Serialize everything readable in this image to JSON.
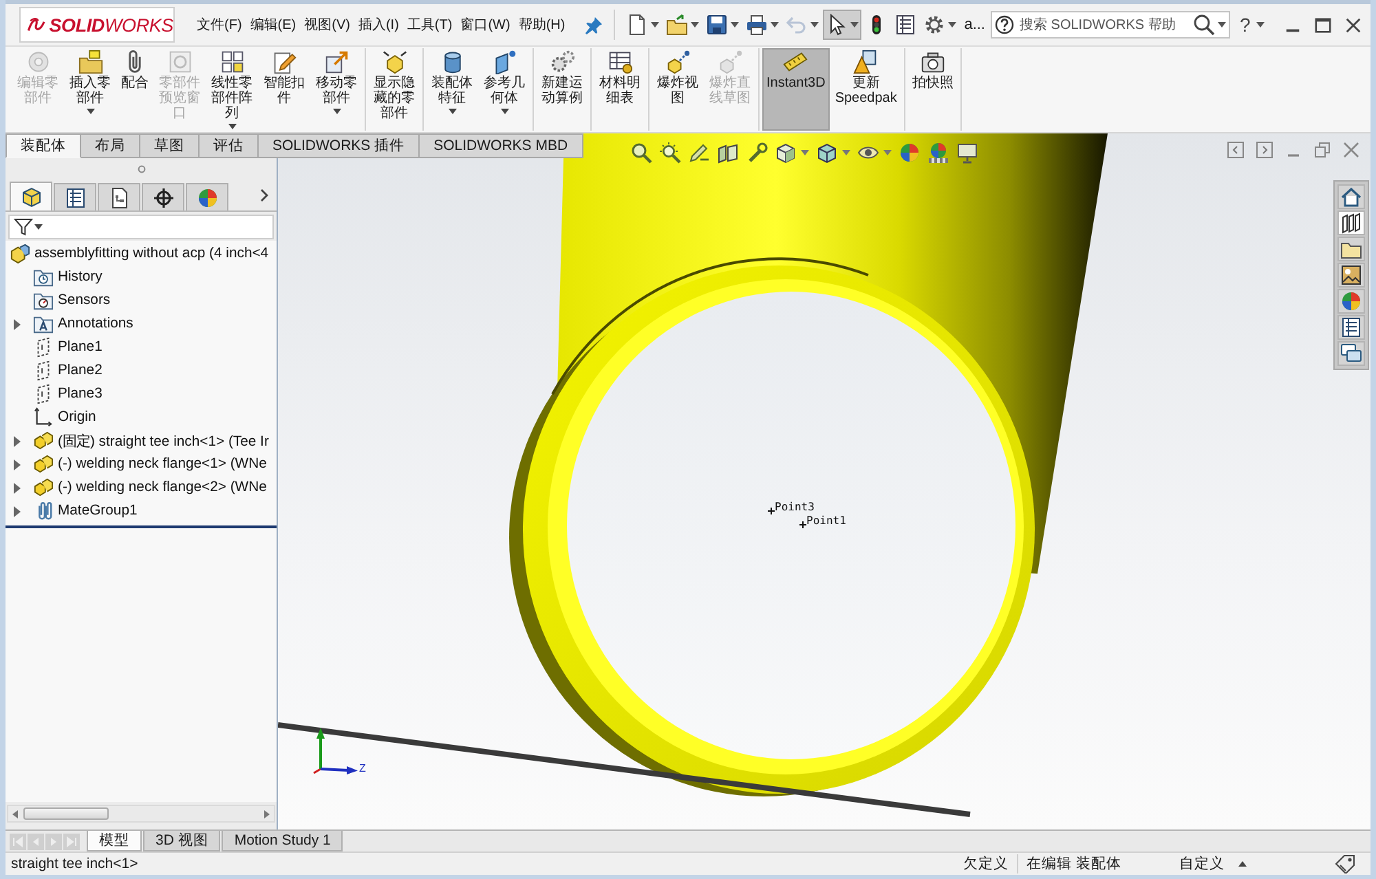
{
  "window": {
    "logo": "**SOLID**WORKS",
    "title": "a..."
  },
  "menu": [
    {
      "label": "文件(F)"
    },
    {
      "label": "编辑(E)"
    },
    {
      "label": "视图(V)"
    },
    {
      "label": "插入(I)"
    },
    {
      "label": "工具(T)"
    },
    {
      "label": "窗口(W)"
    },
    {
      "label": "帮助(H)"
    }
  ],
  "quick_access": [
    {
      "has_menu": true,
      "disabled": false,
      "pressed": false
    },
    {
      "has_menu": true,
      "disabled": false,
      "pressed": false
    },
    {
      "has_menu": true,
      "disabled": false,
      "pressed": false
    },
    {
      "has_menu": true,
      "disabled": false,
      "pressed": false
    },
    {
      "has_menu": true,
      "disabled": true,
      "pressed": false
    },
    {
      "has_menu": true,
      "disabled": false,
      "pressed": true
    },
    {
      "has_menu": false,
      "disabled": false,
      "pressed": false
    },
    {
      "has_menu": false,
      "disabled": false,
      "pressed": false
    },
    {
      "has_menu": true,
      "disabled": false,
      "pressed": false
    }
  ],
  "search": {
    "placeholder": "搜索 SOLIDWORKS 帮助"
  },
  "help": {
    "label": "?"
  },
  "ribbon": {
    "groups": [
      [
        {
          "label": "编辑零部件",
          "disabled": true,
          "has_menu": false,
          "pressed": false
        },
        {
          "label": "插入零部件",
          "disabled": false,
          "has_menu": true,
          "pressed": false
        },
        {
          "label": "配合",
          "disabled": false,
          "has_menu": false,
          "pressed": false
        },
        {
          "label": "零部件预览窗口",
          "disabled": true,
          "has_menu": false,
          "pressed": false
        },
        {
          "label": "线性零部件阵列",
          "disabled": false,
          "has_menu": true,
          "pressed": false
        },
        {
          "label": "智能扣件",
          "disabled": false,
          "has_menu": false,
          "pressed": false
        },
        {
          "label": "移动零部件",
          "disabled": false,
          "has_menu": true,
          "pressed": false
        }
      ],
      [
        {
          "label": "显示隐藏的零部件",
          "disabled": false,
          "has_menu": false,
          "pressed": false
        }
      ],
      [
        {
          "label": "装配体特征",
          "disabled": false,
          "has_menu": true,
          "pressed": false
        },
        {
          "label": "参考几何体",
          "disabled": false,
          "has_menu": true,
          "pressed": false
        }
      ],
      [
        {
          "label": "新建运动算例",
          "disabled": false,
          "has_menu": false,
          "pressed": false
        }
      ],
      [
        {
          "label": "材料明细表",
          "disabled": false,
          "has_menu": false,
          "pressed": false
        }
      ],
      [
        {
          "label": "爆炸视图",
          "disabled": false,
          "has_menu": false,
          "pressed": false
        },
        {
          "label": "爆炸直线草图",
          "disabled": true,
          "has_menu": false,
          "pressed": false
        }
      ],
      [
        {
          "label": "Instant3D",
          "disabled": false,
          "has_menu": false,
          "pressed": true
        },
        {
          "label": "更新 Speedpak",
          "disabled": false,
          "has_menu": false,
          "pressed": false
        }
      ],
      [
        {
          "label": "拍快照",
          "disabled": false,
          "has_menu": false,
          "pressed": false
        }
      ]
    ]
  },
  "command_tabs": [
    {
      "label": "装配体",
      "selected": true
    },
    {
      "label": "布局",
      "selected": false
    },
    {
      "label": "草图",
      "selected": false
    },
    {
      "label": "评估",
      "selected": false
    },
    {
      "label": "SOLIDWORKS 插件",
      "selected": false
    },
    {
      "label": "SOLIDWORKS MBD",
      "selected": false
    }
  ],
  "panel": {
    "tabs": [
      {
        "selected": true
      },
      {
        "selected": false
      },
      {
        "selected": false
      },
      {
        "selected": false
      },
      {
        "selected": false
      }
    ],
    "tree": [
      {
        "label": "assemblyfitting without acp (4 inch<4",
        "kind": "assembly",
        "collapsed": false,
        "children": [
          {
            "label": "History",
            "kind": "history",
            "collapsed": false
          },
          {
            "label": "Sensors",
            "kind": "sensors",
            "collapsed": false
          },
          {
            "label": "Annotations",
            "kind": "annotations",
            "collapsed": true
          },
          {
            "label": "Plane1",
            "kind": "plane",
            "collapsed": false
          },
          {
            "label": "Plane2",
            "kind": "plane",
            "collapsed": false
          },
          {
            "label": "Plane3",
            "kind": "plane",
            "collapsed": false
          },
          {
            "label": "Origin",
            "kind": "origin",
            "collapsed": false
          },
          {
            "label": "(固定) straight tee inch<1> (Tee Ir",
            "kind": "part",
            "collapsed": true
          },
          {
            "label": "(-) welding neck flange<1> (WNe",
            "kind": "part",
            "collapsed": true
          },
          {
            "label": "(-) welding neck flange<2> (WNe",
            "kind": "part",
            "collapsed": true
          },
          {
            "label": "MateGroup1",
            "kind": "mates",
            "collapsed": true
          }
        ]
      }
    ]
  },
  "viewport": {
    "point_labels": [
      "Point3",
      "Point1"
    ],
    "triad_label": "Z",
    "task_pane": [
      {
        "selected": false
      },
      {
        "selected": true
      },
      {
        "selected": false
      },
      {
        "selected": false
      },
      {
        "selected": false
      },
      {
        "selected": false
      },
      {
        "selected": false
      }
    ]
  },
  "bottom_tabs": [
    {
      "label": "模型",
      "selected": true
    },
    {
      "label": "3D 视图",
      "selected": false
    },
    {
      "label": "Motion Study 1",
      "selected": false
    }
  ],
  "status_bar": {
    "message": "straight tee inch<1>",
    "fields": [
      "欠定义",
      "在编辑 装配体",
      "自定义"
    ]
  }
}
